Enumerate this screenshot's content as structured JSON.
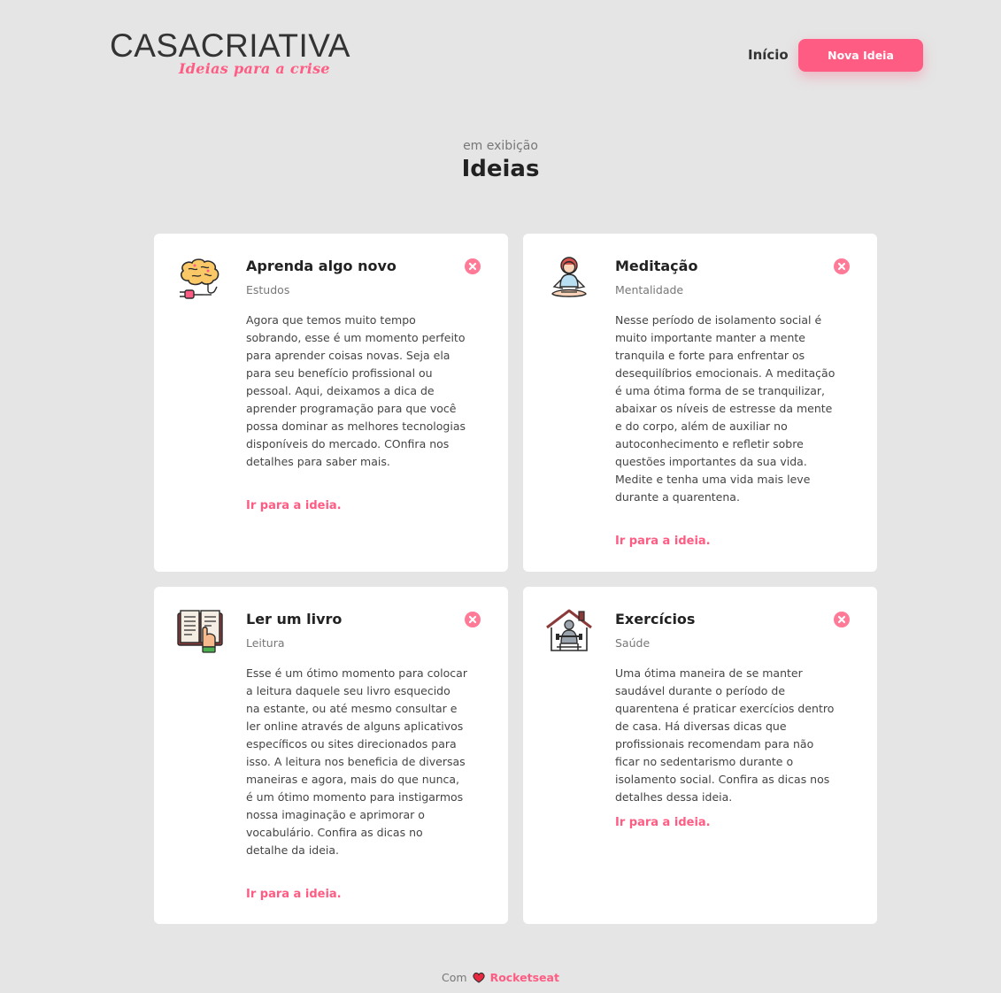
{
  "header": {
    "logo_main": "CASACRIATIVA",
    "logo_sub": "Ideias para a crise",
    "nav_home": "Início",
    "nav_new_idea": "Nova Ideia"
  },
  "intro": {
    "subtitle": "em exibição",
    "title": "Ideias"
  },
  "ideas": [
    {
      "title": "Aprenda algo novo",
      "category": "Estudos",
      "description": "Agora que temos muito tempo sobrando, esse é um momento perfeito para aprender coisas novas. Seja ela para seu benefício profissional ou pessoal. Aqui, deixamos a dica de aprender programação para que você possa dominar as melhores tecnologias disponíveis do mercado. COnfira nos detalhes para saber mais.",
      "link": "Ir para a ideia.",
      "icon": "brain-plug-icon"
    },
    {
      "title": "Meditação",
      "category": "Mentalidade",
      "description": "Nesse período de isolamento social é muito importante manter a mente tranquila e forte para enfrentar os desequilíbrios emocionais. A meditação é uma ótima forma de se tranquilizar, abaixar os níveis de estresse da mente e do corpo, além de auxiliar no autoconhecimento e refletir sobre questões importantes da sua vida. Medite e tenha uma vida mais leve durante a quarentena.",
      "link": "Ir para a ideia.",
      "icon": "meditation-icon"
    },
    {
      "title": "Ler um livro",
      "category": "Leitura",
      "description": "Esse é um ótimo momento para colocar a leitura daquele seu livro esquecido na estante, ou até mesmo consultar e ler online através de alguns aplicativos específicos ou sites direcionados para isso. A leitura nos beneficia de diversas maneiras e agora, mais do que nunca, é um ótimo momento para instigarmos nossa imaginação e aprimorar o vocabulário. Confira as dicas no detalhe da ideia.",
      "link": "Ir para a ideia.",
      "icon": "book-icon"
    },
    {
      "title": "Exercícios",
      "category": "Saúde",
      "description": "Uma ótima maneira de se manter saudável durante o período de quarentena é praticar exercícios dentro de casa. Há diversas dicas que profissionais recomendam para não ficar no sedentarismo durante o isolamento social. Confira as dicas nos detalhes dessa ideia.",
      "link": "Ir para a ideia.",
      "icon": "home-workout-icon"
    }
  ],
  "footer": {
    "prefix": "Com",
    "brand": "Rocketseat"
  },
  "colors": {
    "accent": "#ff5c83",
    "background": "#e5e5e5",
    "card": "#ffffff"
  }
}
